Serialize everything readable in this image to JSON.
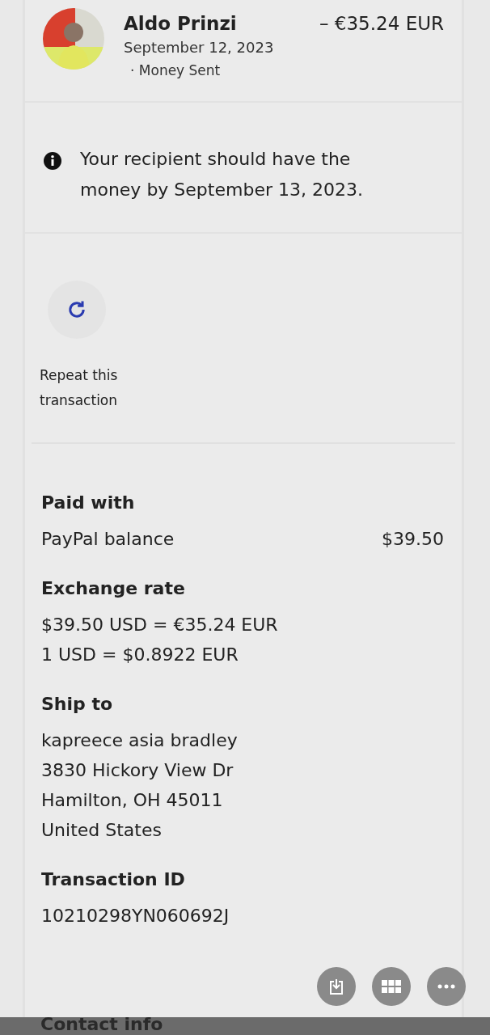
{
  "transaction": {
    "name": "Aldo Prinzi",
    "amount": "– €35.24 EUR",
    "date": "September 12, 2023",
    "status": "· Money Sent"
  },
  "notice": "Your recipient should have the money by September 13, 2023.",
  "actions": [
    {
      "label_line_1": "Repeat this",
      "label_line_2": "transaction"
    }
  ],
  "details": [
    {
      "kind": "row",
      "title": "Paid with",
      "label": "PayPal balance",
      "value": "$39.50"
    },
    {
      "kind": "lines",
      "title": "Exchange rate",
      "lines": [
        "$39.50 USD = €35.24 EUR",
        "1 USD = $0.8922 EUR"
      ]
    },
    {
      "kind": "lines",
      "title": "Ship to",
      "lines": [
        "kapreece asia bradley",
        "3830 Hickory View Dr",
        "Hamilton, OH 45011",
        "United States"
      ]
    },
    {
      "kind": "lines",
      "title": "Transaction ID",
      "lines": [
        "10210298YN060692J"
      ]
    }
  ],
  "footer_heading": "Contact info"
}
